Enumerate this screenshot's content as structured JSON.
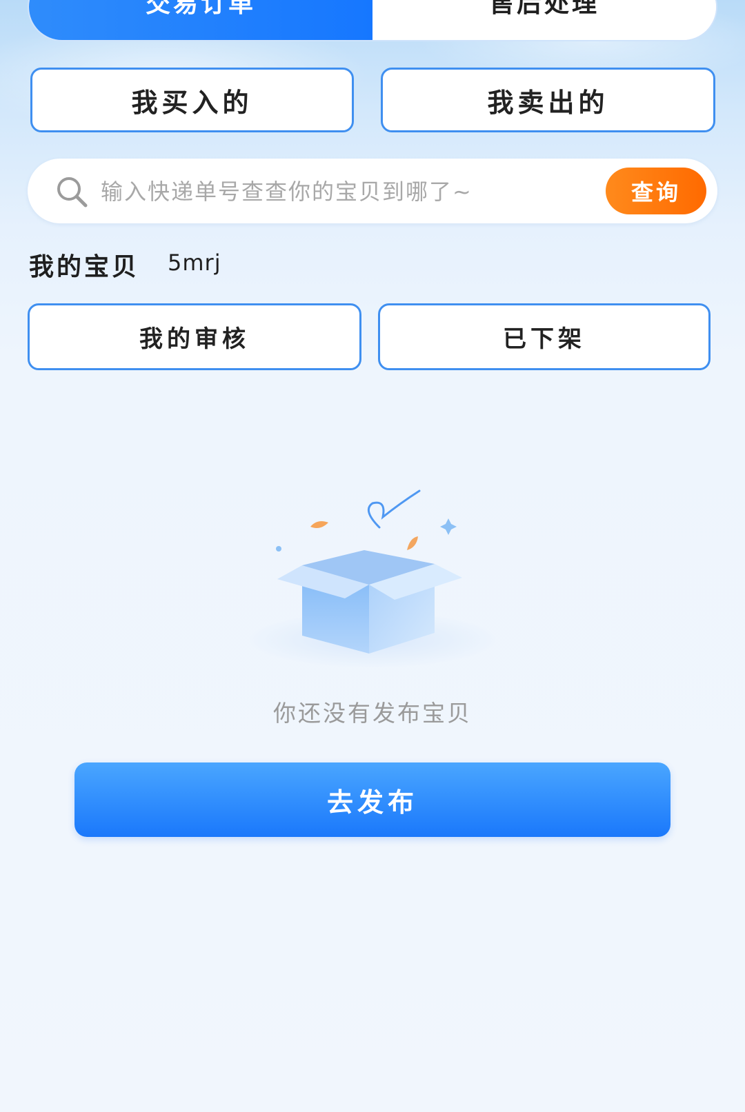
{
  "top_tabs": [
    {
      "label": "交易订单",
      "active": true
    },
    {
      "label": "售后处理",
      "active": false
    }
  ],
  "order_buttons": {
    "bought": "我买入的",
    "sold": "我卖出的"
  },
  "search": {
    "placeholder": "输入快递单号查查你的宝贝到哪了~",
    "button_label": "查询"
  },
  "my_items": {
    "title": "我的宝贝",
    "username": "5mrj",
    "buttons": {
      "review": "我的审核",
      "delisted": "已下架"
    }
  },
  "empty_state": {
    "message": "你还没有发布宝贝",
    "action_label": "去发布",
    "illustration": "open-box-icon"
  },
  "colors": {
    "primary": "#1677ff",
    "accent_orange": "#ff6a00",
    "border_blue": "#3f8ff0",
    "muted_text": "#9a9a9a"
  }
}
